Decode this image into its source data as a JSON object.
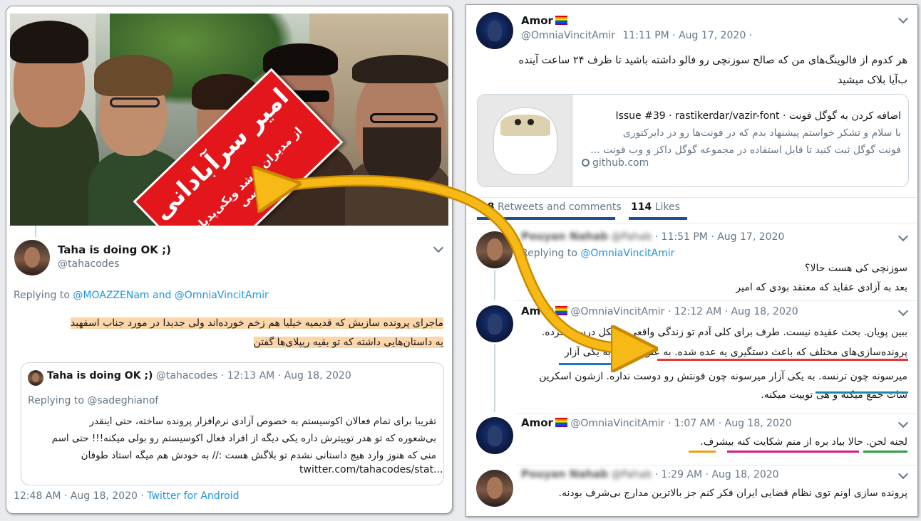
{
  "left": {
    "photo": {
      "banner_name": "امیر سرآبادانی",
      "banner_sub": "از مدیران ارشد ویکی‌پدیای فارسی"
    },
    "reply_tweet": {
      "name": "Taha is doing OK ;)",
      "handle": "@tahacodes",
      "replying_prefix": "Replying to",
      "replying_to_1": "@MOAZZENam",
      "replying_and": "and",
      "replying_to_2": "@OmniaVincitAmir",
      "text_line1": "ماجرای پرونده سازیش که قدیمیه خیلیا هم زخم خورده‌اند ولی جدیدا در مورد جناب اسفهبد",
      "text_line2": "یه داستان‌هایی داشته که تو بقیه ریپلای‌ها گفتن",
      "timestamp": "12:48 AM · Aug 18, 2020",
      "separator": "·",
      "source": "Twitter for Android"
    },
    "quoted": {
      "name": "Taha is doing OK ;)",
      "handle": "@tahacodes",
      "time": "· 12:13 AM · Aug 18, 2020",
      "replying": "Replying to @sadeghianof",
      "line1": "تقریبا برای تمام فعالان اکوسیستم به خصوص آزادی نرم‌افزار پرونده ساخته، حتی اینقدر",
      "line2": "بی‌شعوره که تو هدر توییترش داره یکی دیگه از افراد فعال اکوسیستم رو بولی میکنه!!! حتی اسم",
      "line3": "منی که هنوز وارد هیچ داستانی نشدم تو بلاگش هست :// به خودش هم میگه استاد طوفان",
      "line4": "twitter.com/tahacodes/stat..."
    }
  },
  "right": {
    "main_tweet": {
      "name": "Amor",
      "handle": "@OmniaVincitAmir",
      "time": "11:11 PM · Aug 17, 2020 ·",
      "line1": "هر کدوم از فالوینگ‌های من که صالح سوزنچی رو فالو داشته باشید تا ظرف ۲۴ ساعت آینده",
      "line2": "ب‌آیا بلاک میشید",
      "card_title": "اضافه کردن به گوگل فونت · Issue #39 · rastikerdar/vazir-font",
      "card_line1": "با سلام و تشکر خواستم پیشنهاد بدم که در فونت‌ها رو در دایرکتوری",
      "card_line2": "فونت گوگل ثبت کنید تا قابل استفاده در مجموعه گوگل داکز و وب فونت ...",
      "card_domain": "github.com"
    },
    "stats": {
      "retweets_count": "28",
      "retweets_label": "Retweets and comments",
      "likes_count": "114",
      "likes_label": "Likes"
    },
    "replies": [
      {
        "name": "Pouyan Nahab",
        "handle": "@Pahab",
        "time": "11:51 PM · Aug 17, 2020",
        "replying_prefix": "Replying to",
        "replying_to": "@OmniaVincitAmir",
        "lines": [
          "سوزنچی کی هست حالا؟",
          "بعد به آزادی عقاید که معتقد بودی که امیر"
        ]
      },
      {
        "name": "Amor",
        "handle": "@OmniaVincitAmir",
        "time": "12:12 AM · Aug 18, 2020",
        "lines": [
          "ببین پویان. بحث عقیده نیست. طرف برای کلی آدم تو زندگی واقعی مشکل درست کرده.",
          "پرونده‌سازی‌های مختلف که باعث دستگیری یه عده شده. به عنوان مثال به یکی آزار",
          "میرسونه چون ترنسه. به یکی آزار میرسونه چون فونتش رو دوست نداره. ازشون اسکرین",
          "شات جمع میکنه و هی توییت میکنه."
        ]
      },
      {
        "name": "Amor",
        "handle": "@OmniaVincitAmir",
        "time": "1:07 AM · Aug 18, 2020",
        "lines": [
          "لجنه لجن. حالا بیاد بره از منم شکایت کنه بیشرف."
        ]
      },
      {
        "name": "Pouyan Nahab",
        "handle": "@Pahab",
        "time": "1:29 AM · Aug 18, 2020",
        "lines": [
          "پرونده سازی اونم توی نظام قضایی ایران فکر کنم جز بالاترین مدارج بی‌شرف بودنه."
        ]
      }
    ]
  },
  "colors": {
    "link": "#1b95e0",
    "highlight": "#fcd5a9",
    "banner_red": "#e2161b",
    "arrow_yellow": "#f7b916",
    "underline_red": "#e53935",
    "underline_blue": "#1976d2",
    "underline_teal": "#1e88a8",
    "underline_orange": "#f39c12",
    "underline_pink": "#d81b8a",
    "underline_green": "#2e9e44"
  }
}
